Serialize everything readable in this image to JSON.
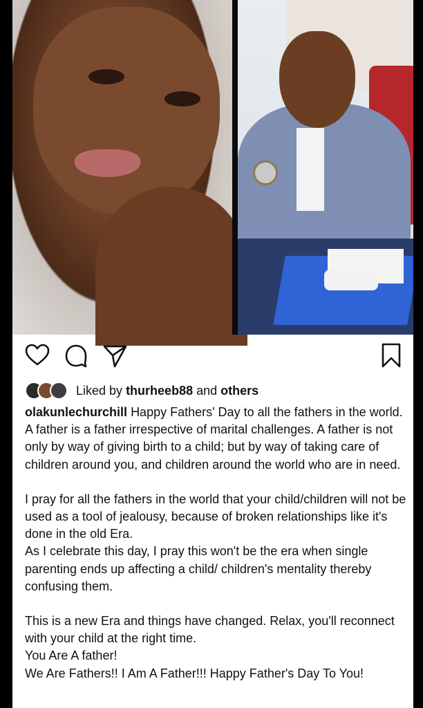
{
  "post": {
    "photos": [
      {
        "name": "child-photo"
      },
      {
        "name": "man-photo"
      }
    ],
    "actions": {
      "like_icon": "heart-icon",
      "comment_icon": "comment-icon",
      "share_icon": "send-icon",
      "save_icon": "bookmark-icon"
    },
    "likes": {
      "prefix": "Liked by",
      "user": "thurheeb88",
      "connector": "and",
      "suffix": "others"
    },
    "caption": {
      "username": "olakunlechurchill",
      "para1": "Happy Fathers' Day to all the fathers in the world. A father is a father irrespective of marital challenges. A father is not only by way of giving birth to a child; but by way of taking care of children around you, and children around the world who are in need.",
      "para2": "I pray for all the fathers in the world that your child/children will not be used as a  tool of jealousy, because of broken relationships like it's done in the old Era.",
      "para3": "As I celebrate this day, I pray this won't be the era when single parenting ends up affecting a child/ children's mentality thereby confusing them.",
      "para4": "This is a new Era and things have changed. Relax, you'll reconnect with your child at the right time.",
      "line5": "You Are A father!",
      "line6": "We Are Fathers!! I Am A Father!!! Happy Father's Day To You!"
    }
  }
}
